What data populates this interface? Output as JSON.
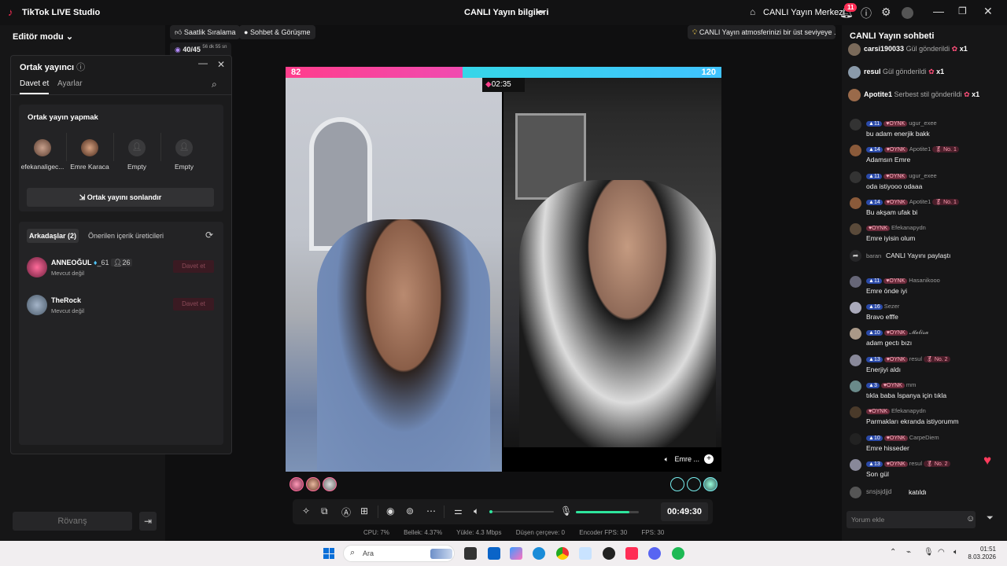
{
  "window": {
    "app_title": "TikTok LIVE Studio",
    "center_title": "CANLI Yayın bilgileri",
    "live_center": "CANLI Yayın Merkezi",
    "notification_count": "11"
  },
  "left": {
    "mode": "Editör modu",
    "rematch": "Rövanş"
  },
  "chips": {
    "hourly_ranking": "Saatlik Sıralama",
    "chat_meeting": "Sohbet & Görüşme",
    "progress": "40/45",
    "progress_time": "56 dk 55 sn",
    "tip": "CANLI Yayın atmosferinizi bir üst seviyeye ..."
  },
  "cohost": {
    "title": "Ortak yayıncı",
    "tab_invite": "Davet et",
    "tab_settings": "Ayarlar",
    "section_title": "Ortak yayın yapmak",
    "slots": [
      "efekanaligec...",
      "Emre Karaca",
      "Empty",
      "Empty"
    ],
    "end_button": "Ortak yayını sonlandır",
    "friends_tab": "Arkadaşlar (2)",
    "suggested_tab": "Önerilen içerik üreticileri",
    "friends": [
      {
        "name": "ANNEOĞUL",
        "suffix": "_61",
        "followers": "26",
        "status": "Mevcut değil",
        "invite": "Davet et"
      },
      {
        "name": "TheRock",
        "status": "Mevcut değil",
        "invite": "Davet et"
      }
    ]
  },
  "battle": {
    "left_score": "82",
    "right_score": "120",
    "timer": "02:35",
    "right_name": "Emre ..."
  },
  "controls": {
    "elapsed": "00:49:30",
    "volume_level": 0,
    "mic_level": 0.85
  },
  "stats": {
    "cpu": "CPU: 7%",
    "memory": "Bellek: 4.37%",
    "upload": "Yükle: 4.3 Mbps",
    "dropped": "Düşen çerçeve: 0",
    "encoder_fps": "Encoder FPS: 30",
    "fps": "FPS: 30"
  },
  "chat": {
    "title": "CANLI Yayın sohbeti",
    "gifts": [
      {
        "user": "carsi190033",
        "action": "Gül gönderildi",
        "count": "x1"
      },
      {
        "user": "resul",
        "action": "Gül gönderildi",
        "count": "x1"
      },
      {
        "user": "Apotite1",
        "action": "Serbest stil gönderildi",
        "count": "x1"
      }
    ],
    "messages": [
      {
        "level": "11",
        "tag": "OYNK",
        "user": "ugur_exee",
        "rank": "",
        "text": "bu adam enerjik bakk"
      },
      {
        "level": "14",
        "tag": "OYNK",
        "user": "Apotite1",
        "rank": "No. 1",
        "text": "Adamsın Emre"
      },
      {
        "level": "11",
        "tag": "OYNK",
        "user": "ugur_exee",
        "rank": "",
        "text": "oda istiyooo odaaa"
      },
      {
        "level": "14",
        "tag": "OYNK",
        "user": "Apotite1",
        "rank": "No. 1",
        "text": "Bu akşam ufak bi"
      },
      {
        "level": "",
        "tag": "OYNK",
        "user": "Efekanapydn",
        "rank": "",
        "text": "Emre iyisin olum"
      },
      {
        "level": "",
        "tag": "",
        "user": "baran",
        "rank": "",
        "text": "CANLI Yayını paylaştı"
      },
      {
        "level": "11",
        "tag": "OYNK",
        "user": "Hasanikooo",
        "rank": "",
        "text": "Emre önde iyi"
      },
      {
        "level": "16",
        "tag": "",
        "user": "Sezer",
        "rank": "",
        "text": "Bravo efffe"
      },
      {
        "level": "10",
        "tag": "OYNK",
        "user": "𝓜𝓮𝓵𝓲𝓼𝓪",
        "rank": "",
        "text": "adam gectı bızı"
      },
      {
        "level": "13",
        "tag": "OYNK",
        "user": "resul",
        "rank": "No. 2",
        "text": "Enerjiyi aldı"
      },
      {
        "level": "3",
        "tag": "OYNK",
        "user": "mm",
        "rank": "",
        "text": "tıkla baba İspanya için tıkla"
      },
      {
        "level": "",
        "tag": "OYNK",
        "user": "Efekanapydn",
        "rank": "",
        "text": "Parmakları ekranda istiyorumm"
      },
      {
        "level": "10",
        "tag": "OYNK",
        "user": "CarpeDiem",
        "rank": "",
        "text": "Emre hisseder"
      },
      {
        "level": "13",
        "tag": "OYNK",
        "user": "resul",
        "rank": "No. 2",
        "text": "Son gül"
      }
    ],
    "join_user": "snsjsjdjjd",
    "join_text": "katıldı",
    "input_placeholder": "Yorum ekle"
  },
  "taskbar": {
    "search": "Ara",
    "time": "01:51",
    "date": "8.03.2026"
  },
  "colors": {
    "accent": "#ff2d55",
    "battle_left": "#ff3e8c",
    "battle_right": "#36d6e8",
    "level_badge": "#2b4aa8"
  }
}
